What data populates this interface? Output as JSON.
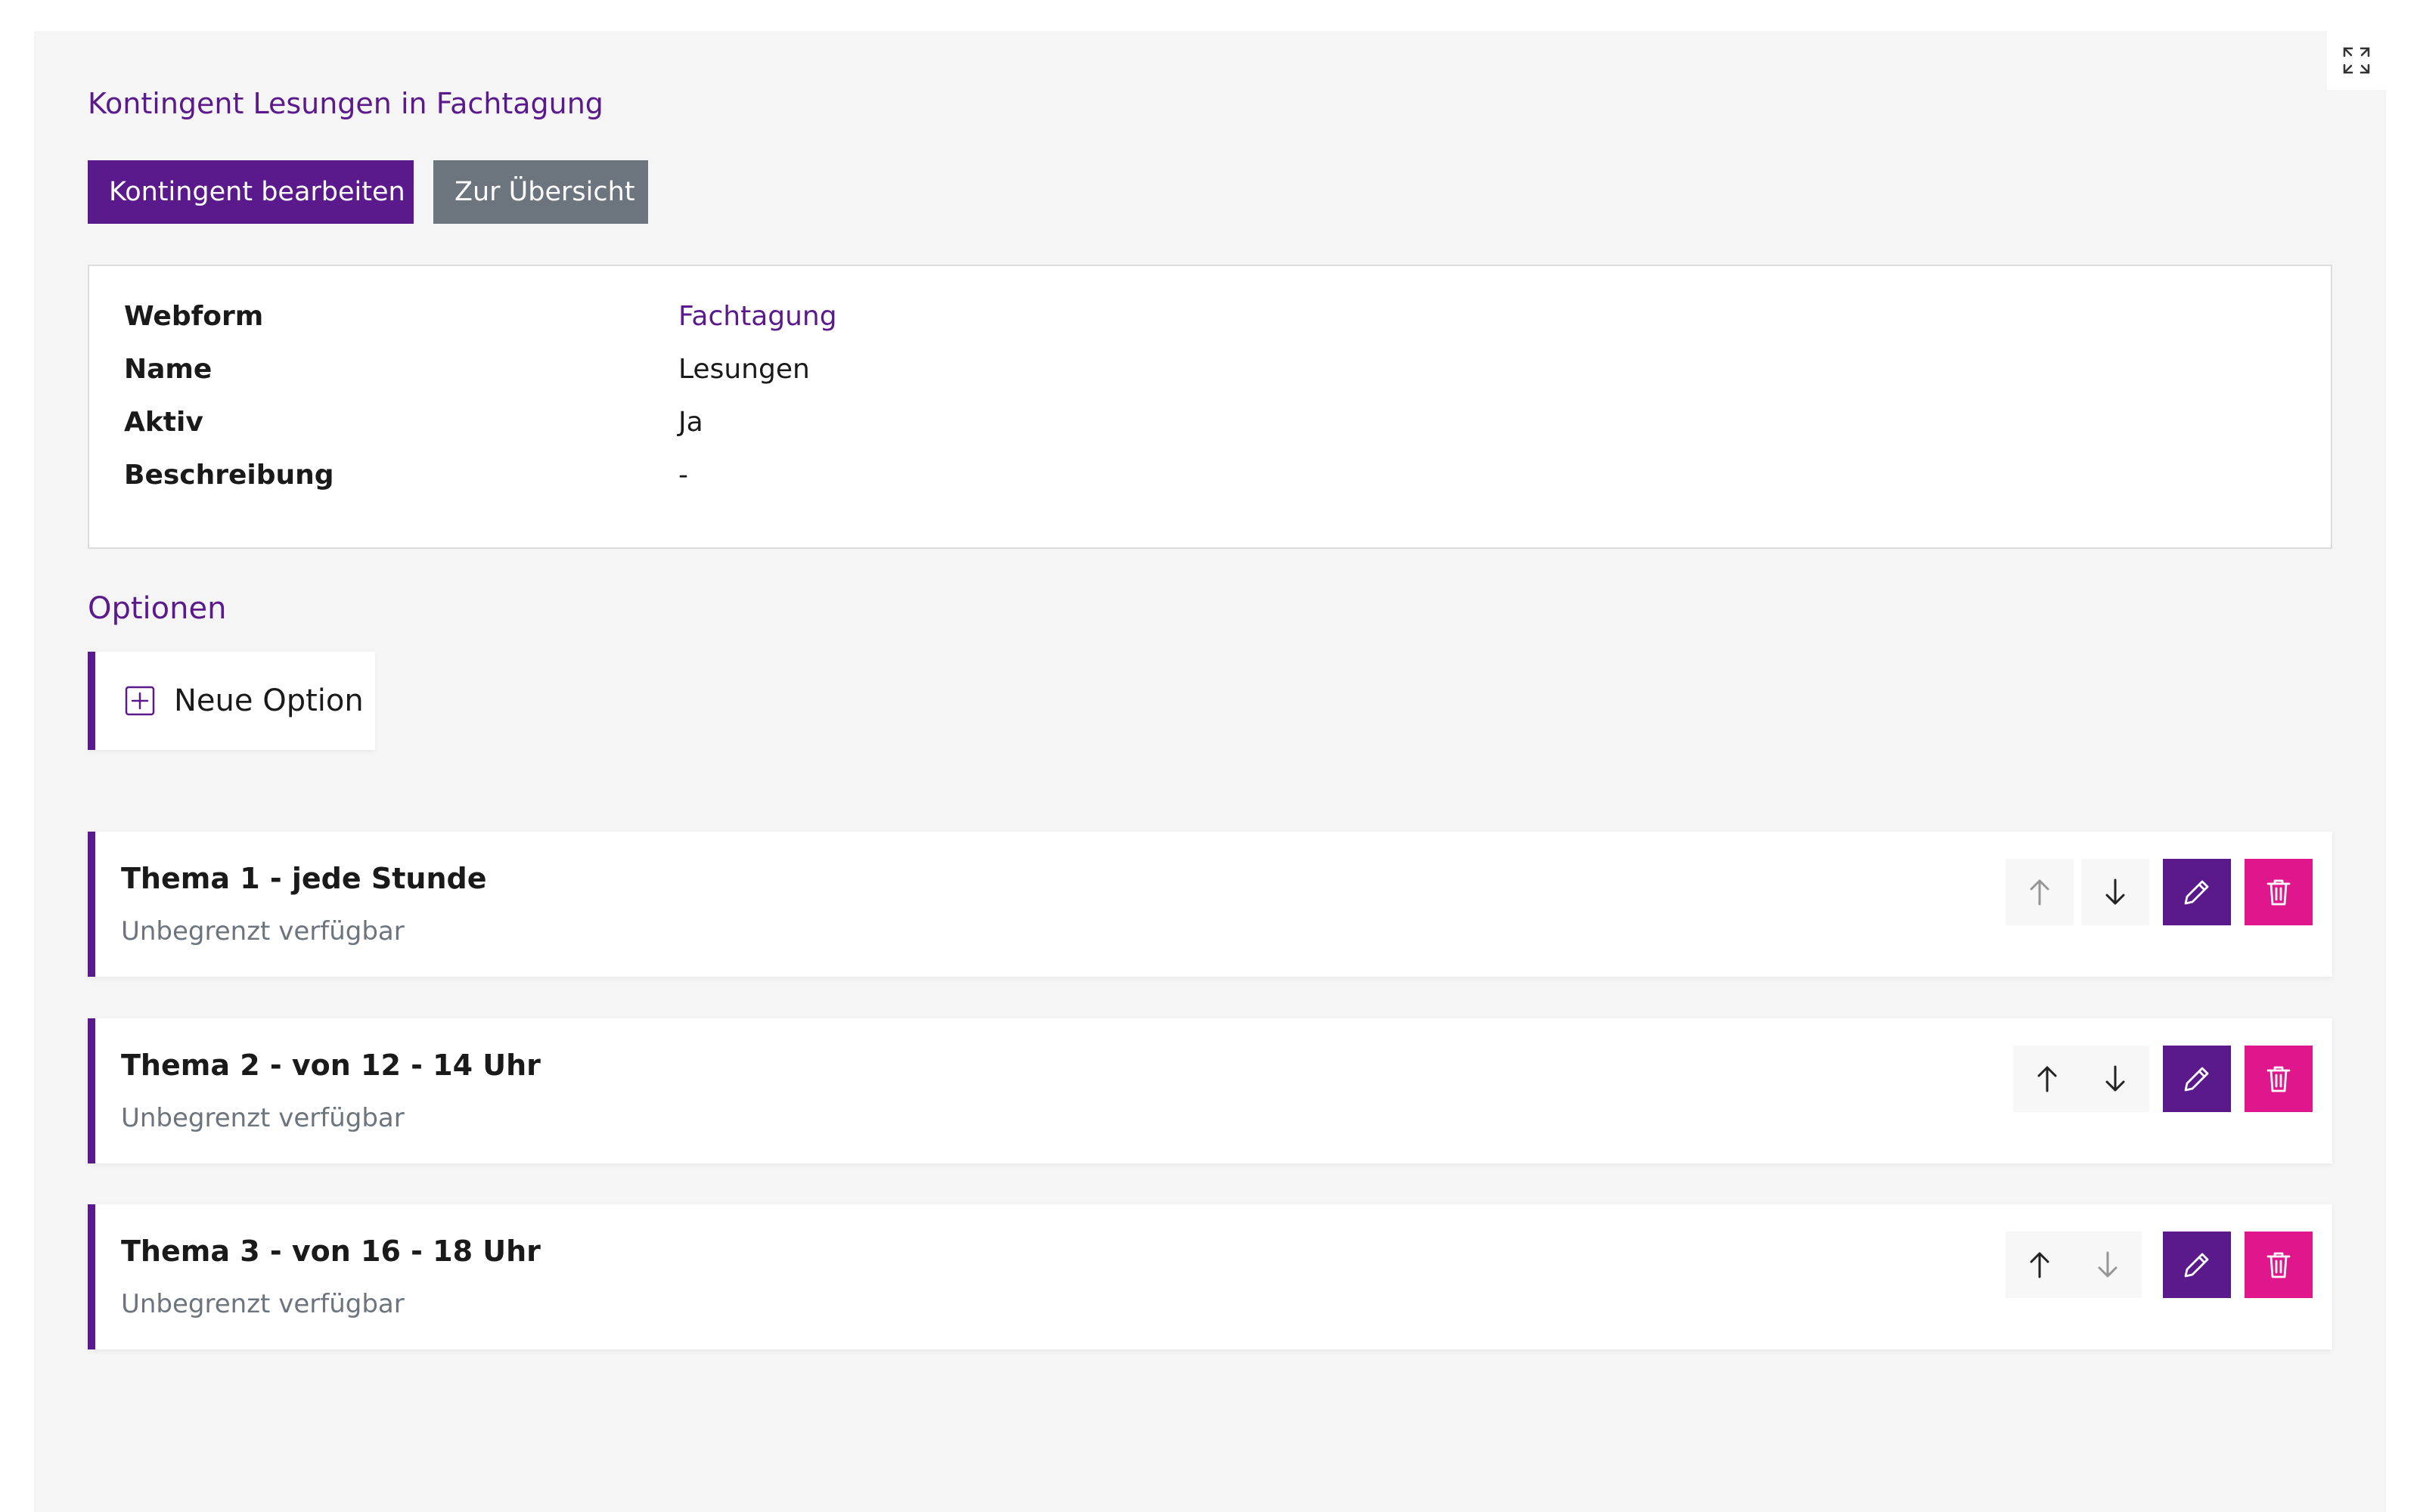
{
  "header": {
    "title": "Kontingent Lesungen in Fachtagung"
  },
  "actions": {
    "edit_label": "Kontingent bearbeiten",
    "overview_label": "Zur Übersicht"
  },
  "details": {
    "rows": [
      {
        "label": "Webform",
        "value": "Fachtagung"
      },
      {
        "label": "Name",
        "value": "Lesungen"
      },
      {
        "label": "Aktiv",
        "value": "Ja"
      },
      {
        "label": "Beschreibung",
        "value": "-"
      }
    ]
  },
  "options_section": {
    "title": "Optionen",
    "new_option_label": "Neue Option",
    "items": [
      {
        "title": "Thema 1 - jede Stunde",
        "subtitle": "Unbegrenzt verfügbar"
      },
      {
        "title": "Thema 2 - von 12 - 14 Uhr",
        "subtitle": "Unbegrenzt verfügbar"
      },
      {
        "title": "Thema 3 - von 16 - 18 Uhr",
        "subtitle": "Unbegrenzt verfügbar"
      }
    ]
  },
  "colors": {
    "primary": "#5b1a8c",
    "secondary": "#6c757d",
    "danger": "#e0168c",
    "panel_bg": "#f5f5f5"
  },
  "icons": {
    "fullscreen": "expand-icon",
    "new_option": "plus-square-icon",
    "move_up": "arrow-up-icon",
    "move_down": "arrow-down-icon",
    "edit": "pencil-icon",
    "delete": "trash-icon"
  }
}
